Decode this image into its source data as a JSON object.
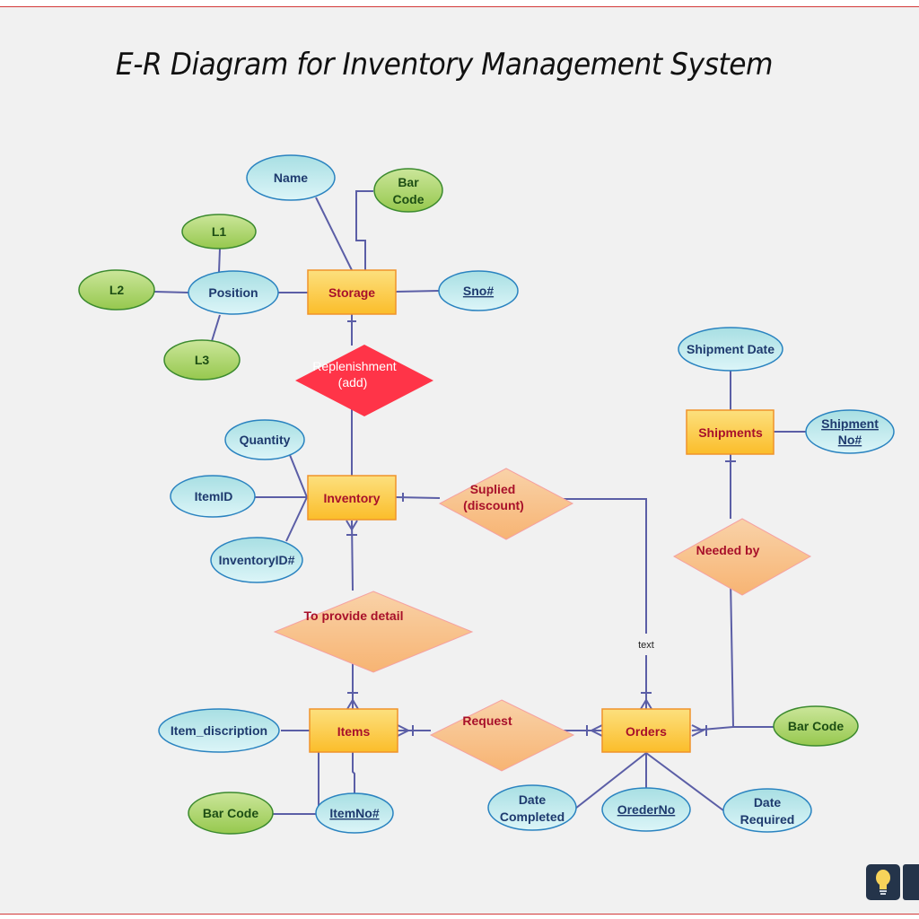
{
  "title": "E-R Diagram for Inventory Management System",
  "colors": {
    "frame_line": "#d33a3a",
    "background": "#f1f1f1",
    "connector": "#5b5ea6",
    "entity_fill": "#fbc83a",
    "entity_border": "#f0932b",
    "entity_text": "#a8102a",
    "attribute_fill": "#bfe9ee",
    "attribute_border": "#2a83c0",
    "attribute_text": "#1e3a6e",
    "composite_fill": "#a9d364",
    "composite_border": "#3b8a2e",
    "composite_text": "#1d4e14",
    "relationship_fill": "#f7c08e",
    "relationship_highlight": "#ff3448"
  },
  "entities": {
    "storage": "Storage",
    "inventory": "Inventory",
    "items": "Items",
    "orders": "Orders",
    "shipments": "Shipments"
  },
  "relationships": {
    "replenishment_line1": "Replenishment",
    "replenishment_line2": "(add)",
    "supplied_line1": "Suplied",
    "supplied_line2": "(discount)",
    "provide_detail": "To provide detail",
    "request": "Request",
    "needed_by": "Needed by"
  },
  "attributes": {
    "storage_name": "Name",
    "storage_barcode_line1": "Bar",
    "storage_barcode_line2": "Code",
    "storage_sno": "Sno#",
    "position": "Position",
    "l1": "L1",
    "l2": "L2",
    "l3": "L3",
    "quantity": "Quantity",
    "itemid": "ItemID",
    "inventoryid": "InventoryID#",
    "shipment_date": "Shipment Date",
    "shipment_no_line1": "Shipment",
    "shipment_no_line2": "No#",
    "item_description": "Item_discription",
    "items_barcode": "Bar Code",
    "itemno": "ItemNo#",
    "date_completed_line1": "Date",
    "date_completed_line2": "Completed",
    "orderno": "OrederNo",
    "date_required_line1": "Date",
    "date_required_line2": "Required",
    "orders_barcode": "Bar Code"
  },
  "connector_label": "text",
  "logo": {
    "icon": "lightbulb-icon"
  }
}
